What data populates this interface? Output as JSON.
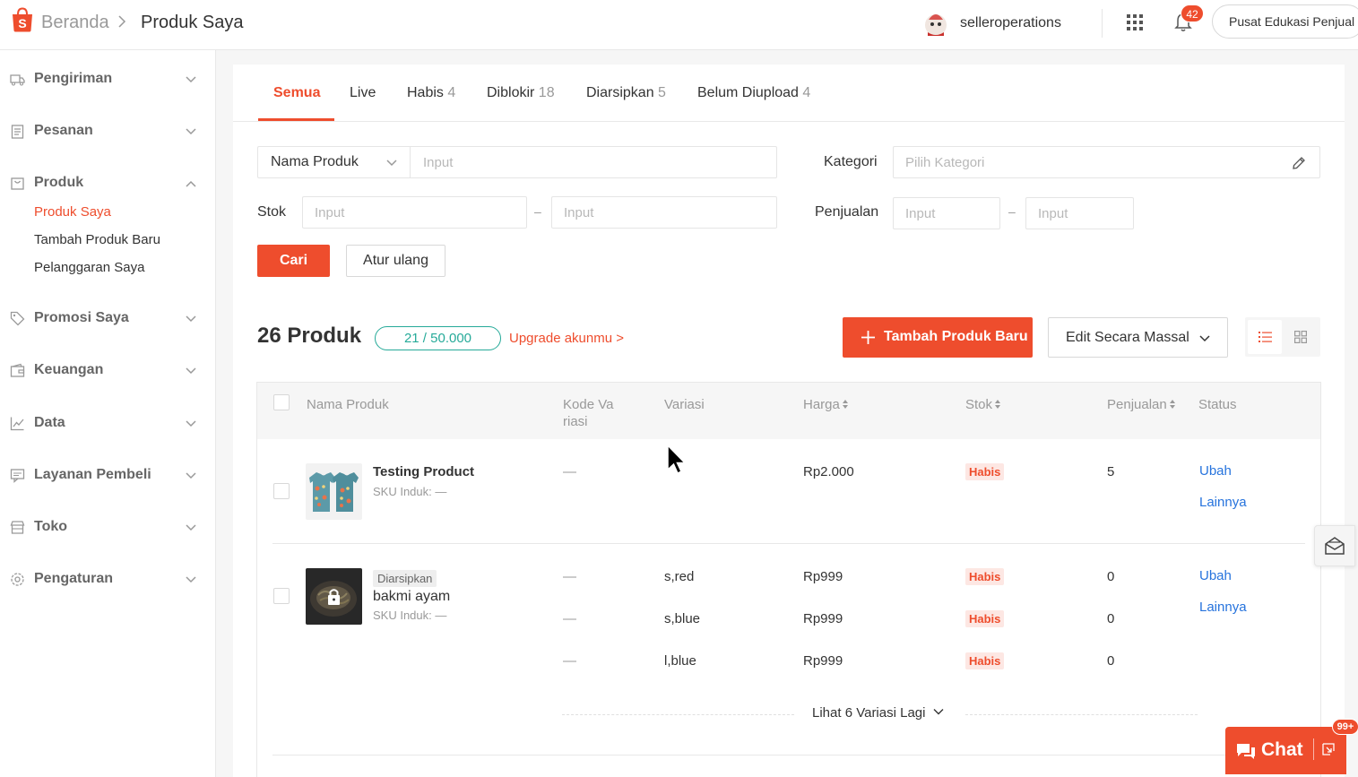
{
  "colors": {
    "brand": "#ee4d2d",
    "link": "#2673dd",
    "quota": "#26aa99"
  },
  "header": {
    "breadcrumb_home": "Beranda",
    "breadcrumb_current": "Produk Saya",
    "username": "selleroperations",
    "notification_count": "42",
    "edu_button": "Pusat Edukasi Penjual"
  },
  "sidebar": {
    "items": [
      {
        "label": "Pengiriman",
        "icon": "truck-icon"
      },
      {
        "label": "Pesanan",
        "icon": "clipboard-icon"
      },
      {
        "label": "Produk",
        "icon": "bag-icon",
        "expanded": true
      },
      {
        "label": "Promosi Saya",
        "icon": "tag-icon"
      },
      {
        "label": "Keuangan",
        "icon": "wallet-icon"
      },
      {
        "label": "Data",
        "icon": "chart-icon"
      },
      {
        "label": "Layanan Pembeli",
        "icon": "chat-icon"
      },
      {
        "label": "Toko",
        "icon": "shop-icon"
      },
      {
        "label": "Pengaturan",
        "icon": "gear-icon"
      }
    ],
    "sub_items": [
      "Produk Saya",
      "Tambah Produk Baru",
      "Pelanggaran Saya"
    ]
  },
  "tabs": [
    {
      "label": "Semua",
      "count": ""
    },
    {
      "label": "Live",
      "count": ""
    },
    {
      "label": "Habis",
      "count": "4"
    },
    {
      "label": "Diblokir",
      "count": "18"
    },
    {
      "label": "Diarsipkan",
      "count": "5"
    },
    {
      "label": "Belum Diupload",
      "count": "4"
    }
  ],
  "filters": {
    "search_type": "Nama Produk",
    "input_placeholder": "Input",
    "category_label": "Kategori",
    "category_placeholder": "Pilih Kategori",
    "stock_label": "Stok",
    "sales_label": "Penjualan",
    "dash": "–",
    "search_button": "Cari",
    "reset_button": "Atur ulang"
  },
  "summary": {
    "product_count": "26 Produk",
    "quota": "21 / 50.000",
    "upgrade": "Upgrade akunmu >",
    "add_button": "Tambah Produk Baru",
    "bulk_edit": "Edit Secara Massal"
  },
  "table": {
    "headers": {
      "name": "Nama Produk",
      "variant_code": "Kode Va",
      "variant_code_2": "riasi",
      "variant": "Variasi",
      "price": "Harga",
      "stock": "Stok",
      "sales": "Penjualan",
      "status": "Status"
    },
    "rows": [
      {
        "name": "Testing Product",
        "sku": "SKU Induk: —",
        "variants": [
          {
            "code": "—",
            "variant": "",
            "price": "Rp2.000",
            "stock": "Habis",
            "sales": "5"
          }
        ],
        "action_edit": "Ubah",
        "action_more": "Lainnya"
      },
      {
        "tag": "Diarsipkan",
        "name": "bakmi ayam",
        "sku": "SKU Induk: —",
        "variants": [
          {
            "code": "—",
            "variant": "s,red",
            "price": "Rp999",
            "stock": "Habis",
            "sales": "0"
          },
          {
            "code": "—",
            "variant": "s,blue",
            "price": "Rp999",
            "stock": "Habis",
            "sales": "0"
          },
          {
            "code": "—",
            "variant": "l,blue",
            "price": "Rp999",
            "stock": "Habis",
            "sales": "0"
          }
        ],
        "action_edit": "Ubah",
        "action_more": "Lainnya",
        "more_variants": "Lihat 6 Variasi Lagi"
      }
    ]
  },
  "chat": {
    "label": "Chat",
    "badge": "99+"
  }
}
